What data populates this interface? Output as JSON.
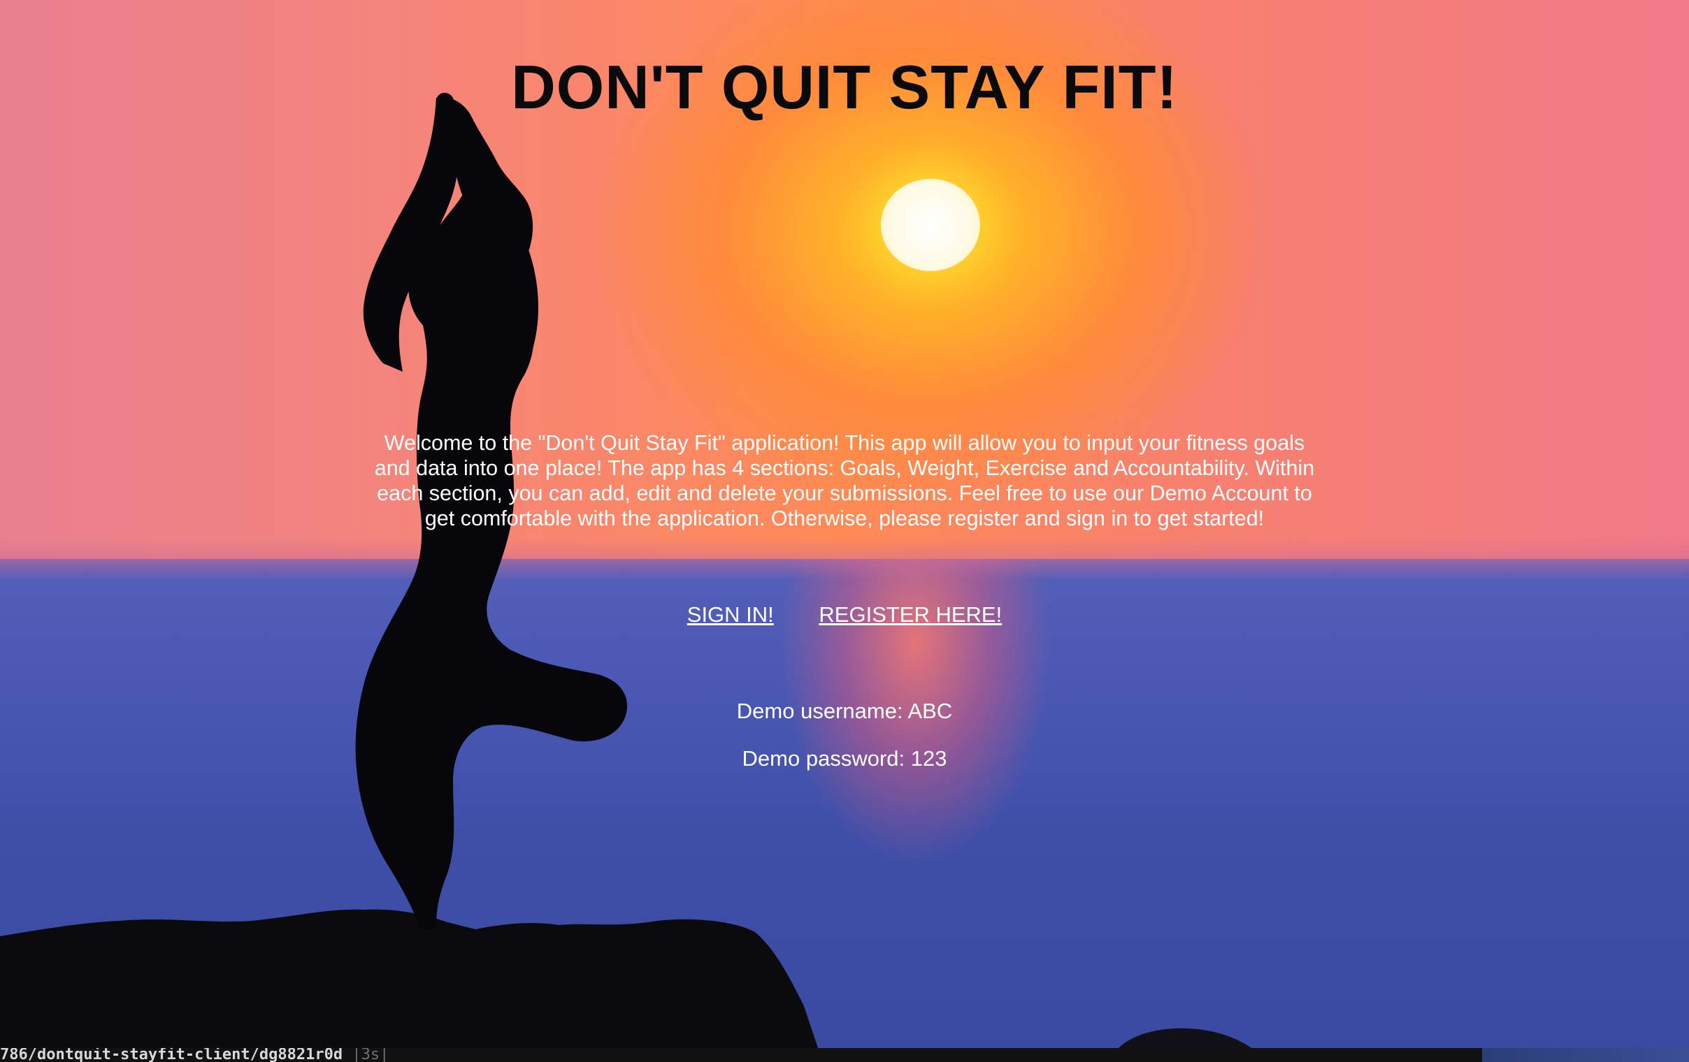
{
  "header": {
    "title": "DON'T QUIT STAY FIT!"
  },
  "intro": {
    "text": "Welcome to the \"Don't Quit Stay Fit\" application! This app will allow you to input your fitness goals and data into one place! The app has 4 sections: Goals, Weight, Exercise and Accountability. Within each section, you can add, edit and delete your submissions. Feel free to use our Demo Account to get comfortable with the application. Otherwise, please register and sign in to get started!"
  },
  "nav": {
    "sign_in_label": "SIGN IN!",
    "register_label": "REGISTER HERE!"
  },
  "demo": {
    "username_text": "Demo username: ABC",
    "password_text": "Demo password: 123"
  },
  "status_bar": {
    "path_text": "786/dontquit-stayfit-client/dg8821r0d",
    "time_text": "|3s|"
  },
  "colors": {
    "title": "#0a0a0a",
    "body_text": "#ffffff",
    "sun": "#ffd21f",
    "sea": "#4a58b4"
  }
}
